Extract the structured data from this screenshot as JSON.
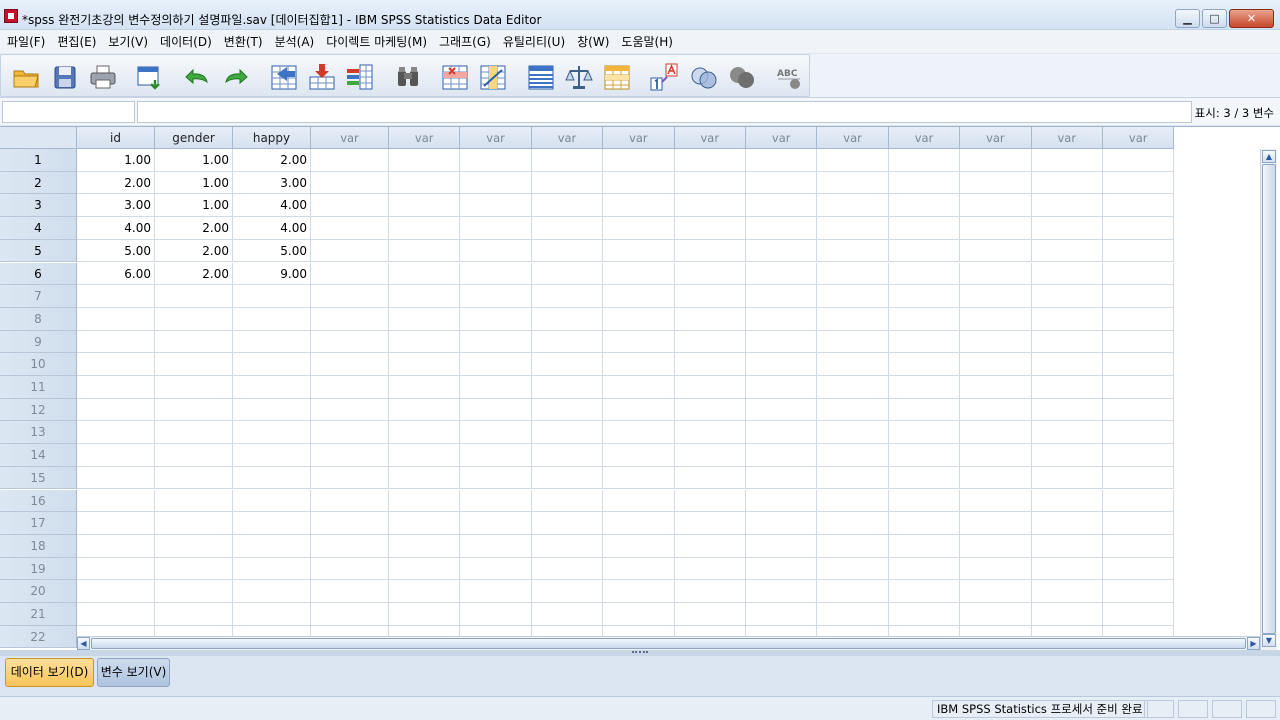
{
  "window": {
    "title": "*spss 완전기초강의 변수정의하기 설명파일.sav [데이터집합1] - IBM SPSS Statistics Data Editor",
    "minimize": "▁",
    "maximize": "□",
    "close": "✕"
  },
  "menu": [
    {
      "label": "파일(F)"
    },
    {
      "label": "편집(E)"
    },
    {
      "label": "보기(V)"
    },
    {
      "label": "데이터(D)"
    },
    {
      "label": "변환(T)"
    },
    {
      "label": "분석(A)"
    },
    {
      "label": "다이렉트 마케팅(M)"
    },
    {
      "label": "그래프(G)"
    },
    {
      "label": "유틸리티(U)"
    },
    {
      "label": "창(W)"
    },
    {
      "label": "도움말(H)"
    }
  ],
  "toolbar": {
    "icons": [
      "open-data-icon",
      "save-icon",
      "print-icon",
      "dialog-recall-icon",
      "undo-icon",
      "redo-icon",
      "goto-case-icon",
      "goto-variable-icon",
      "variables-icon",
      "find-icon",
      "insert-cases-icon",
      "insert-variable-icon",
      "split-file-icon",
      "weight-cases-icon",
      "select-cases-icon",
      "value-labels-icon",
      "use-variable-sets-icon",
      "show-all-variables-icon",
      "spell-check-icon"
    ]
  },
  "cellbar": {
    "cell_ref": "",
    "cell_value": "",
    "visible_count": "표시: 3 / 3 변수"
  },
  "grid": {
    "columns": [
      "id",
      "gender",
      "happy",
      "var",
      "var",
      "var",
      "var",
      "var",
      "var",
      "var",
      "var",
      "var",
      "var",
      "var",
      "var"
    ],
    "row_numbers": [
      "1",
      "2",
      "3",
      "4",
      "5",
      "6",
      "7",
      "8",
      "9",
      "10",
      "11",
      "12",
      "13",
      "14",
      "15",
      "16",
      "17",
      "18",
      "19",
      "20",
      "21",
      "22"
    ],
    "data": [
      [
        "1.00",
        "1.00",
        "2.00"
      ],
      [
        "2.00",
        "1.00",
        "3.00"
      ],
      [
        "3.00",
        "1.00",
        "4.00"
      ],
      [
        "4.00",
        "2.00",
        "4.00"
      ],
      [
        "5.00",
        "2.00",
        "5.00"
      ],
      [
        "6.00",
        "2.00",
        "9.00"
      ]
    ]
  },
  "tabs": {
    "data_view": "데이터 보기(D)",
    "variable_view": "변수 보기(V)"
  },
  "status": {
    "text": "IBM SPSS Statistics 프로세서 준비 완료"
  },
  "colors": {
    "active_tab": "#f7c45a",
    "header_bg": "#d5e1ef",
    "grid_line": "#d0dbe7"
  }
}
